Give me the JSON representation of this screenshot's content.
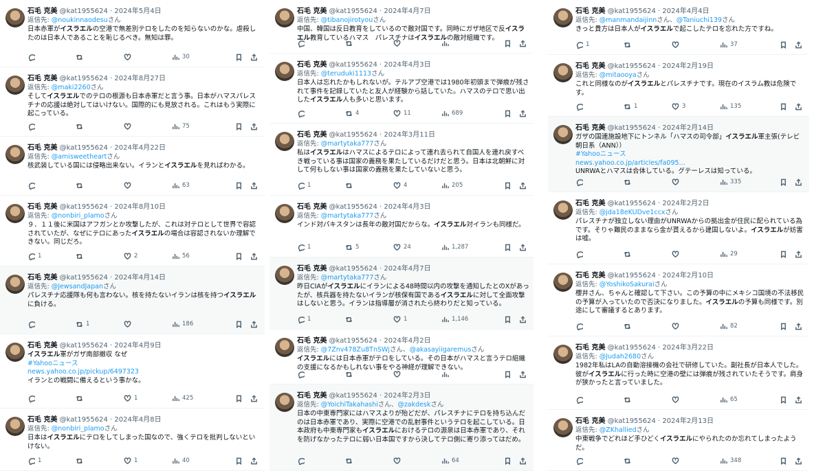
{
  "author": {
    "name": "石毛 克美",
    "handle": "@kat1955624"
  },
  "reply_prefix": "返信先: ",
  "reply_suffix": "さん",
  "reply_joiner": "、",
  "icons": [
    "reply-icon",
    "retweet-icon",
    "like-icon",
    "views-icon",
    "bookmark-icon",
    "share-icon"
  ],
  "columns": [
    {
      "tweets": [
        {
          "date": "2024年5月4日",
          "reply_to": [
            "@noukinnaodesu"
          ],
          "segments": [
            [
              "日本赤軍が",
              false
            ],
            [
              "イスラエル",
              true
            ],
            [
              "の空港で無差別テロをしたのを知らないのかな。虐殺したのは日本人であることを恥じるべき。無知は罪。",
              false
            ]
          ],
          "replies": "",
          "retweets": "",
          "likes": "",
          "views": "30"
        },
        {
          "date": "2024年8月27日",
          "reply_to": [
            "@maki2260"
          ],
          "segments": [
            [
              "そして",
              false
            ],
            [
              "イスラエル",
              true
            ],
            [
              "でのテロの根源も日本赤軍だと言う事。日本がハマスパレスチナの応援は絶対してはいけない。国際的にも見放される。これはもう実際に起こっている。",
              false
            ]
          ],
          "replies": "",
          "retweets": "",
          "likes": "",
          "views": "75"
        },
        {
          "date": "2024年4月22日",
          "reply_to": [
            "@amisweetheart"
          ],
          "segments": [
            [
              "核武装している国には侵略出来ない。イランと",
              false
            ],
            [
              "イスラエル",
              true
            ],
            [
              "を見ればわかる。",
              false
            ]
          ],
          "replies": "",
          "retweets": "",
          "likes": "",
          "views": "63"
        },
        {
          "date": "2024年8月10日",
          "reply_to": [
            "@nonbiri_plamo"
          ],
          "segments": [
            [
              "９．１１後に米国はアフガンとか攻撃したが、これは対テロとして世界で容認されていたが、なぜにテロにあった",
              false
            ],
            [
              "イスラエル",
              true
            ],
            [
              "の場合は容認されないか理解できない。同じだろ。",
              false
            ]
          ],
          "replies": "1",
          "retweets": "",
          "likes": "2",
          "views": "56"
        },
        {
          "date": "2024年4月14日",
          "reply_to": [
            "@JewsandJapan"
          ],
          "segments": [
            [
              "パレスチナ応援隊も何も言わない。核を持たないイランは核を持つ",
              false
            ],
            [
              "イスラエル",
              true
            ],
            [
              "に負ける。",
              false
            ]
          ],
          "replies": "",
          "retweets": "1",
          "likes": "",
          "views": "186"
        },
        {
          "date": "2024年4月9日",
          "reply_to": [],
          "segments": [
            [
              "イスラエル",
              true
            ],
            [
              "軍がガザ南部撤収 なぜ",
              false
            ]
          ],
          "links": [
            "#Yahooニュース",
            "news.yahoo.co.jp/pickup/6497323"
          ],
          "after": "イランとの戦闘に備えるという事かな。",
          "replies": "",
          "retweets": "",
          "likes": "1",
          "views": "425"
        },
        {
          "date": "2024年4月8日",
          "reply_to": [
            "@nonbiri_plamo"
          ],
          "segments": [
            [
              "日本は",
              false
            ],
            [
              "イスラエル",
              true
            ],
            [
              "にテロをしてしまった国なので、強くテロを批判しないといけない。",
              false
            ]
          ],
          "replies": "1",
          "retweets": "",
          "likes": "1",
          "views": "40"
        }
      ]
    },
    {
      "tweets": [
        {
          "date": "2024年4月7日",
          "reply_to": [
            "@tibanojirotyou"
          ],
          "segments": [
            [
              "中国、韓国は反日教育をしているので敵対国です。同時にガザ地区で反",
              false
            ],
            [
              "イスラエル",
              true
            ],
            [
              "教育しているハマス　パレスチナは",
              false
            ],
            [
              "イスラエル",
              true
            ],
            [
              "の敵対組織です。",
              false
            ]
          ],
          "replies": "",
          "retweets": "",
          "likes": "",
          "views": ""
        },
        {
          "date": "2024年4月3日",
          "reply_to": [
            "@teruduki1113"
          ],
          "segments": [
            [
              "日本人は忘れたかもしれないが。テルアブ空港では1980年初頭まで弾痕が残されて事件を記録していたと友人が経験から話していた。ハマスのテロで思い出した",
              false
            ],
            [
              "イスラエル",
              true
            ],
            [
              "人も多いと思います。",
              false
            ]
          ],
          "replies": "",
          "retweets": "4",
          "likes": "11",
          "views": "689"
        },
        {
          "date": "2024年3月11日",
          "reply_to": [
            "@martytaka777"
          ],
          "segments": [
            [
              "私は",
              false
            ],
            [
              "イスラエル",
              true
            ],
            [
              "はハマスによるテロによって連れ去られて自国人を連れ戻すべき戦っている事は国家の義務を果たしているだけだと思う。日本は北朝鮮に対して何もしない事は国家の義務を果たしていないと思う。",
              false
            ]
          ],
          "replies": "1",
          "retweets": "",
          "likes": "4",
          "views": "205"
        },
        {
          "date": "2024年4月3日",
          "reply_to": [
            "@martytaka777"
          ],
          "segments": [
            [
              "インド対パキスタンは長年の敵対国だからな。",
              false
            ],
            [
              "イスラエル",
              true
            ],
            [
              "対イランも同様だ。",
              false
            ]
          ],
          "replies": "1",
          "retweets": "5",
          "likes": "24",
          "views": "1,287"
        },
        {
          "date": "2024年4月7日",
          "reply_to": [
            "@martytaka777"
          ],
          "segments": [
            [
              "昨日CIAが",
              false
            ],
            [
              "イスラエル",
              true
            ],
            [
              "にイランによる48時間以内の攻撃を通知したとのXがあったが、核兵器を持たないイランが核保有国である",
              false
            ],
            [
              "イスラエル",
              true
            ],
            [
              "に対して全面攻撃はしないと思う。イランは指導層が消されたら終わりだと知っている。",
              false
            ]
          ],
          "replies": "1",
          "retweets": "",
          "likes": "1",
          "views": "1,146"
        },
        {
          "date": "2024年4月2日",
          "reply_to": [
            "@7Znv478Zu8TnSWj",
            "@akasayiigaremus"
          ],
          "segments": [
            [
              "イスラエル",
              true
            ],
            [
              "には日本赤軍がテロをしている。その日本がハマスと言うテロ組織の支援になるかもしれない事をやる神経が理解できない。",
              false
            ]
          ],
          "replies": "",
          "retweets": "",
          "likes": "",
          "views": ""
        },
        {
          "date": "2024年2月3日",
          "reply_to": [
            "@YoichiTakahashi",
            "@zakdesk"
          ],
          "segments": [
            [
              "日本の中東専門家にはハマスよりが殆どだが、パレスチナにテロを持ち込んだのは日本赤軍であり、実際に空港での乱射事件というテロを起こしている。日本政府も中東専門家も",
              false
            ],
            [
              "イスラエル",
              true
            ],
            [
              "におけるテロの源泉は日本赤軍であり、それを防げなかったテロに弱い日本国ですから決してテロ側に寄り添ってはだめ。",
              false
            ]
          ],
          "replies": "",
          "retweets": "",
          "likes": "",
          "views": "64"
        }
      ]
    },
    {
      "tweets": [
        {
          "date": "2024年4月4日",
          "reply_to": [
            "@manmandaijinn",
            "@Taniuchi139"
          ],
          "segments": [
            [
              "きっと貴方は日本人が",
              false
            ],
            [
              "イスラエル",
              true
            ],
            [
              "で起こしたテロを忘れた方ですね。",
              false
            ]
          ],
          "replies": "1",
          "retweets": "",
          "likes": "",
          "views": "37"
        },
        {
          "date": "2024年2月19日",
          "reply_to": [
            "@mitaooya"
          ],
          "segments": [
            [
              "これと同様なのが",
              false
            ],
            [
              "イスラエル",
              true
            ],
            [
              "とパレスチナです。現在のイスラム教は危険です。",
              false
            ]
          ],
          "replies": "",
          "retweets": "1",
          "likes": "3",
          "views": "135"
        },
        {
          "date": "2024年2月14日",
          "reply_to": [],
          "segments": [
            [
              "ガザの国連施設地下にトンネル「ハマスの司令部」",
              false
            ],
            [
              "イスラエル",
              true
            ],
            [
              "軍主張(テレビ朝日系（ANN））",
              false
            ]
          ],
          "links": [
            "#Yahooニュース",
            "news.yahoo.co.jp/articles/fa095..."
          ],
          "after": "UNRWAとハマスは合体している。グテーレスは知っている。",
          "replies": "",
          "retweets": "",
          "likes": "",
          "views": "335"
        },
        {
          "date": "2024年2月2日",
          "reply_to": [
            "@jda18eKUDve1ccx"
          ],
          "segments": [
            [
              "パレスチナが独立しない理由がUNRWAからの拠出金が住民に配られている為です。そりゃ難民のままなら金が貰えるから建国しないよ。",
              false
            ],
            [
              "イスラエル",
              true
            ],
            [
              "が妨害は嘘。",
              false
            ]
          ],
          "replies": "",
          "retweets": "",
          "likes": "",
          "views": "29"
        },
        {
          "date": "2024年2月10日",
          "reply_to": [
            "@YoshikoSakurai"
          ],
          "segments": [
            [
              "櫻井さん、ちゃんと確認して下さい。この予算の中にメキシコ国境の不法移民の予算が入っていたので否決になりました。",
              false
            ],
            [
              "イスラエル",
              true
            ],
            [
              "の予算も同様です。別途にして審議するとあります。",
              false
            ]
          ],
          "replies": "",
          "retweets": "",
          "likes": "",
          "views": "82"
        },
        {
          "date": "2024年3月22日",
          "reply_to": [
            "@Judah2680"
          ],
          "segments": [
            [
              "1982年私はLAの自動溶接機の会社で研修していた。副社長が日本人でした。彼が",
              false
            ],
            [
              "イスラエル",
              true
            ],
            [
              "に行った時に空港の壁には弾痕が残されていたそうです。肩身が狭かったと言っていました。",
              false
            ]
          ],
          "replies": "",
          "retweets": "",
          "likes": "",
          "views": "65"
        },
        {
          "date": "2024年2月13日",
          "reply_to": [
            "@ZKhallied"
          ],
          "segments": [
            [
              "中東戦争でどれほど手ひどく",
              false
            ],
            [
              "イスラエル",
              true
            ],
            [
              "にやられたのか忘れてしまったようだ。",
              false
            ]
          ],
          "replies": "",
          "retweets": "",
          "likes": "",
          "views": "348"
        }
      ]
    }
  ]
}
